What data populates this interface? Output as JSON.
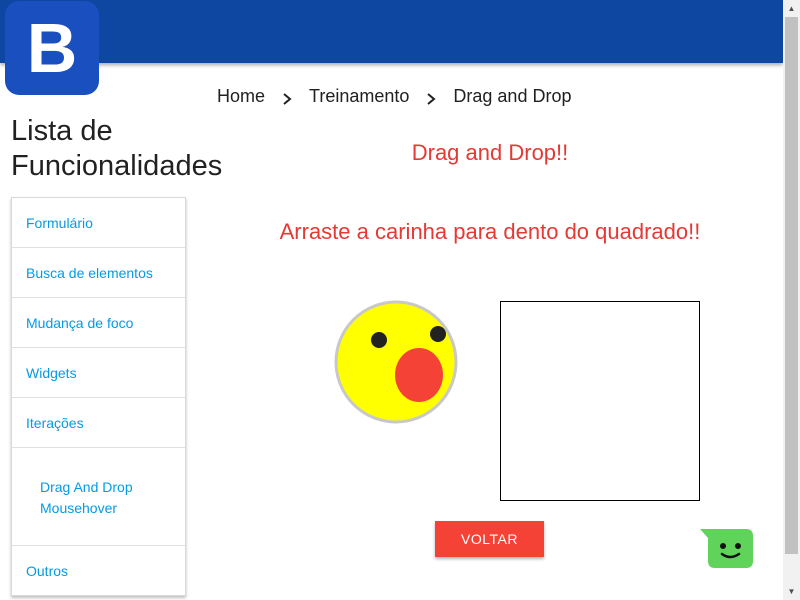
{
  "header": {
    "logo_letter": "B",
    "bar_color": "#0d47a1"
  },
  "breadcrumb": [
    {
      "label": "Home"
    },
    {
      "label": "Treinamento"
    },
    {
      "label": "Drag and Drop"
    }
  ],
  "sidebar": {
    "title": "Lista de Funcionalidades",
    "items": [
      {
        "label": "Formulário"
      },
      {
        "label": "Busca de elementos"
      },
      {
        "label": "Mudança de foco"
      },
      {
        "label": "Widgets"
      },
      {
        "label": "Iterações"
      }
    ],
    "subitems": [
      {
        "label": "Drag And Drop"
      },
      {
        "label": "Mousehover"
      }
    ],
    "last_item": {
      "label": "Outros"
    },
    "link_color": "#039be5"
  },
  "main": {
    "title": "Drag and Drop!!",
    "instruction": "Arraste a carinha para dento do quadrado!!",
    "accent_color": "#e53935",
    "draggable_icon": "surprised-face-icon",
    "back_button": "VOLTAR"
  },
  "chat_widget": {
    "icon": "chat-smiley-icon",
    "color": "#5fd35a"
  }
}
